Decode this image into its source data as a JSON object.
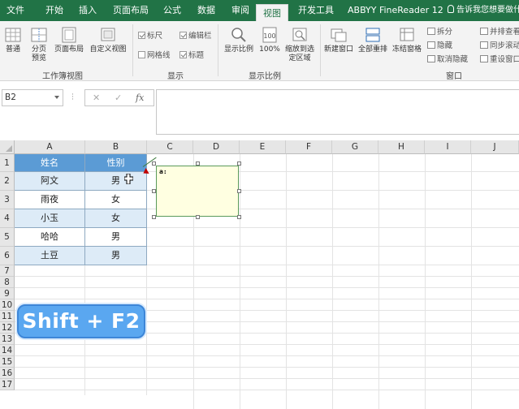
{
  "ribbon_tabs": [
    "文件",
    "开始",
    "插入",
    "页面布局",
    "公式",
    "数据",
    "审阅",
    "视图",
    "开发工具",
    "ABBYY FineReader 12"
  ],
  "active_tab": "视图",
  "tell_me": "告诉我您想要做什",
  "workbook_views": {
    "label": "工作簿视图",
    "buttons": [
      "普通",
      "分页预览",
      "页面布局",
      "自定义视图"
    ]
  },
  "show_group": {
    "label": "显示",
    "items": [
      {
        "label": "标尺",
        "checked": true
      },
      {
        "label": "编辑栏",
        "checked": true
      },
      {
        "label": "网格线",
        "checked": false
      },
      {
        "label": "标题",
        "checked": true
      }
    ]
  },
  "zoom_group": {
    "label": "显示比例",
    "buttons": [
      "显示比例",
      "100%",
      "缩放到选定区域"
    ]
  },
  "window_group": {
    "label": "窗口",
    "buttons": [
      "新建窗口",
      "全部重排",
      "冻结窗格"
    ],
    "small_items": [
      "拆分",
      "隐藏",
      "取消隐藏"
    ],
    "side_items": [
      "并排查看",
      "同步滚动",
      "重设窗口"
    ]
  },
  "name_box": "B2",
  "fx_label": "fx",
  "column_headers": [
    "A",
    "B",
    "C",
    "D",
    "E",
    "F",
    "G",
    "H",
    "I",
    "J"
  ],
  "row_headers": [
    "1",
    "2",
    "3",
    "4",
    "5",
    "6",
    "7",
    "8",
    "9",
    "10",
    "11",
    "12",
    "13",
    "14",
    "15",
    "16",
    "17"
  ],
  "table": {
    "headers": [
      "姓名",
      "性别"
    ],
    "rows": [
      [
        "阿文",
        "男"
      ],
      [
        "雨夜",
        "女"
      ],
      [
        "小玉",
        "女"
      ],
      [
        "哈哈",
        "男"
      ],
      [
        "土豆",
        "男"
      ]
    ]
  },
  "comment_text": "a:",
  "shortcut_badge": "Shift + F2",
  "colors": {
    "excel_green": "#217346",
    "table_header": "#5b9bd5",
    "table_alt_row": "#ddebf7",
    "comment_bg": "#ffffe1",
    "badge": "#5aa7f0"
  }
}
